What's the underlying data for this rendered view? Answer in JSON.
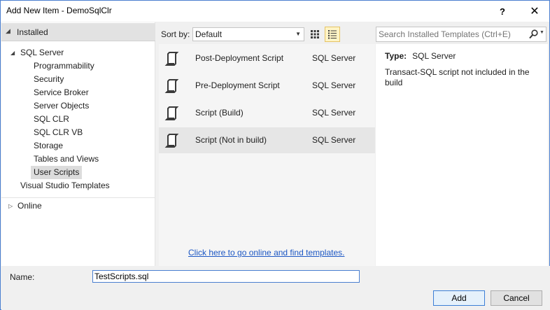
{
  "window": {
    "title": "Add New Item - DemoSqlClr",
    "help": "?",
    "close": "✕"
  },
  "tree": {
    "installed": "Installed",
    "sql_server": "SQL Server",
    "children": [
      "Programmability",
      "Security",
      "Service Broker",
      "Server Objects",
      "SQL CLR",
      "SQL CLR VB",
      "Storage",
      "Tables and Views",
      "User Scripts"
    ],
    "selected": "User Scripts",
    "vs_templates": "Visual Studio Templates",
    "online": "Online"
  },
  "sort": {
    "label": "Sort by:",
    "value": "Default"
  },
  "search": {
    "placeholder": "Search Installed Templates (Ctrl+E)"
  },
  "templates": [
    {
      "name": "Post-Deployment Script",
      "category": "SQL Server"
    },
    {
      "name": "Pre-Deployment Script",
      "category": "SQL Server"
    },
    {
      "name": "Script (Build)",
      "category": "SQL Server"
    },
    {
      "name": "Script (Not in build)",
      "category": "SQL Server"
    }
  ],
  "online_link": "Click here to go online and find templates.",
  "details": {
    "type_label": "Type:",
    "type_value": "SQL Server",
    "description": "Transact-SQL script not included in the build"
  },
  "name_field": {
    "label": "Name:",
    "value": "TestScripts.sql"
  },
  "buttons": {
    "add": "Add",
    "cancel": "Cancel"
  },
  "colors": {
    "accent": "#4a7fd0",
    "link": "#1c57c4",
    "selected_bg": "#e6e6e6"
  }
}
